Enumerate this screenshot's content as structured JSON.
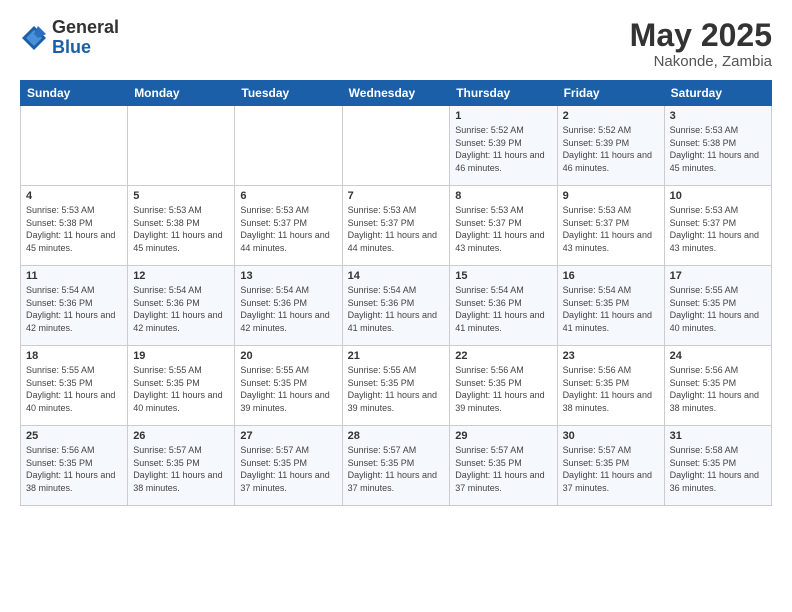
{
  "logo": {
    "general": "General",
    "blue": "Blue"
  },
  "header": {
    "month": "May 2025",
    "location": "Nakonde, Zambia"
  },
  "weekdays": [
    "Sunday",
    "Monday",
    "Tuesday",
    "Wednesday",
    "Thursday",
    "Friday",
    "Saturday"
  ],
  "weeks": [
    [
      {
        "day": "",
        "info": ""
      },
      {
        "day": "",
        "info": ""
      },
      {
        "day": "",
        "info": ""
      },
      {
        "day": "",
        "info": ""
      },
      {
        "day": "1",
        "info": "Sunrise: 5:52 AM\nSunset: 5:39 PM\nDaylight: 11 hours and 46 minutes."
      },
      {
        "day": "2",
        "info": "Sunrise: 5:52 AM\nSunset: 5:39 PM\nDaylight: 11 hours and 46 minutes."
      },
      {
        "day": "3",
        "info": "Sunrise: 5:53 AM\nSunset: 5:38 PM\nDaylight: 11 hours and 45 minutes."
      }
    ],
    [
      {
        "day": "4",
        "info": "Sunrise: 5:53 AM\nSunset: 5:38 PM\nDaylight: 11 hours and 45 minutes."
      },
      {
        "day": "5",
        "info": "Sunrise: 5:53 AM\nSunset: 5:38 PM\nDaylight: 11 hours and 45 minutes."
      },
      {
        "day": "6",
        "info": "Sunrise: 5:53 AM\nSunset: 5:37 PM\nDaylight: 11 hours and 44 minutes."
      },
      {
        "day": "7",
        "info": "Sunrise: 5:53 AM\nSunset: 5:37 PM\nDaylight: 11 hours and 44 minutes."
      },
      {
        "day": "8",
        "info": "Sunrise: 5:53 AM\nSunset: 5:37 PM\nDaylight: 11 hours and 43 minutes."
      },
      {
        "day": "9",
        "info": "Sunrise: 5:53 AM\nSunset: 5:37 PM\nDaylight: 11 hours and 43 minutes."
      },
      {
        "day": "10",
        "info": "Sunrise: 5:53 AM\nSunset: 5:37 PM\nDaylight: 11 hours and 43 minutes."
      }
    ],
    [
      {
        "day": "11",
        "info": "Sunrise: 5:54 AM\nSunset: 5:36 PM\nDaylight: 11 hours and 42 minutes."
      },
      {
        "day": "12",
        "info": "Sunrise: 5:54 AM\nSunset: 5:36 PM\nDaylight: 11 hours and 42 minutes."
      },
      {
        "day": "13",
        "info": "Sunrise: 5:54 AM\nSunset: 5:36 PM\nDaylight: 11 hours and 42 minutes."
      },
      {
        "day": "14",
        "info": "Sunrise: 5:54 AM\nSunset: 5:36 PM\nDaylight: 11 hours and 41 minutes."
      },
      {
        "day": "15",
        "info": "Sunrise: 5:54 AM\nSunset: 5:36 PM\nDaylight: 11 hours and 41 minutes."
      },
      {
        "day": "16",
        "info": "Sunrise: 5:54 AM\nSunset: 5:35 PM\nDaylight: 11 hours and 41 minutes."
      },
      {
        "day": "17",
        "info": "Sunrise: 5:55 AM\nSunset: 5:35 PM\nDaylight: 11 hours and 40 minutes."
      }
    ],
    [
      {
        "day": "18",
        "info": "Sunrise: 5:55 AM\nSunset: 5:35 PM\nDaylight: 11 hours and 40 minutes."
      },
      {
        "day": "19",
        "info": "Sunrise: 5:55 AM\nSunset: 5:35 PM\nDaylight: 11 hours and 40 minutes."
      },
      {
        "day": "20",
        "info": "Sunrise: 5:55 AM\nSunset: 5:35 PM\nDaylight: 11 hours and 39 minutes."
      },
      {
        "day": "21",
        "info": "Sunrise: 5:55 AM\nSunset: 5:35 PM\nDaylight: 11 hours and 39 minutes."
      },
      {
        "day": "22",
        "info": "Sunrise: 5:56 AM\nSunset: 5:35 PM\nDaylight: 11 hours and 39 minutes."
      },
      {
        "day": "23",
        "info": "Sunrise: 5:56 AM\nSunset: 5:35 PM\nDaylight: 11 hours and 38 minutes."
      },
      {
        "day": "24",
        "info": "Sunrise: 5:56 AM\nSunset: 5:35 PM\nDaylight: 11 hours and 38 minutes."
      }
    ],
    [
      {
        "day": "25",
        "info": "Sunrise: 5:56 AM\nSunset: 5:35 PM\nDaylight: 11 hours and 38 minutes."
      },
      {
        "day": "26",
        "info": "Sunrise: 5:57 AM\nSunset: 5:35 PM\nDaylight: 11 hours and 38 minutes."
      },
      {
        "day": "27",
        "info": "Sunrise: 5:57 AM\nSunset: 5:35 PM\nDaylight: 11 hours and 37 minutes."
      },
      {
        "day": "28",
        "info": "Sunrise: 5:57 AM\nSunset: 5:35 PM\nDaylight: 11 hours and 37 minutes."
      },
      {
        "day": "29",
        "info": "Sunrise: 5:57 AM\nSunset: 5:35 PM\nDaylight: 11 hours and 37 minutes."
      },
      {
        "day": "30",
        "info": "Sunrise: 5:57 AM\nSunset: 5:35 PM\nDaylight: 11 hours and 37 minutes."
      },
      {
        "day": "31",
        "info": "Sunrise: 5:58 AM\nSunset: 5:35 PM\nDaylight: 11 hours and 36 minutes."
      }
    ]
  ]
}
